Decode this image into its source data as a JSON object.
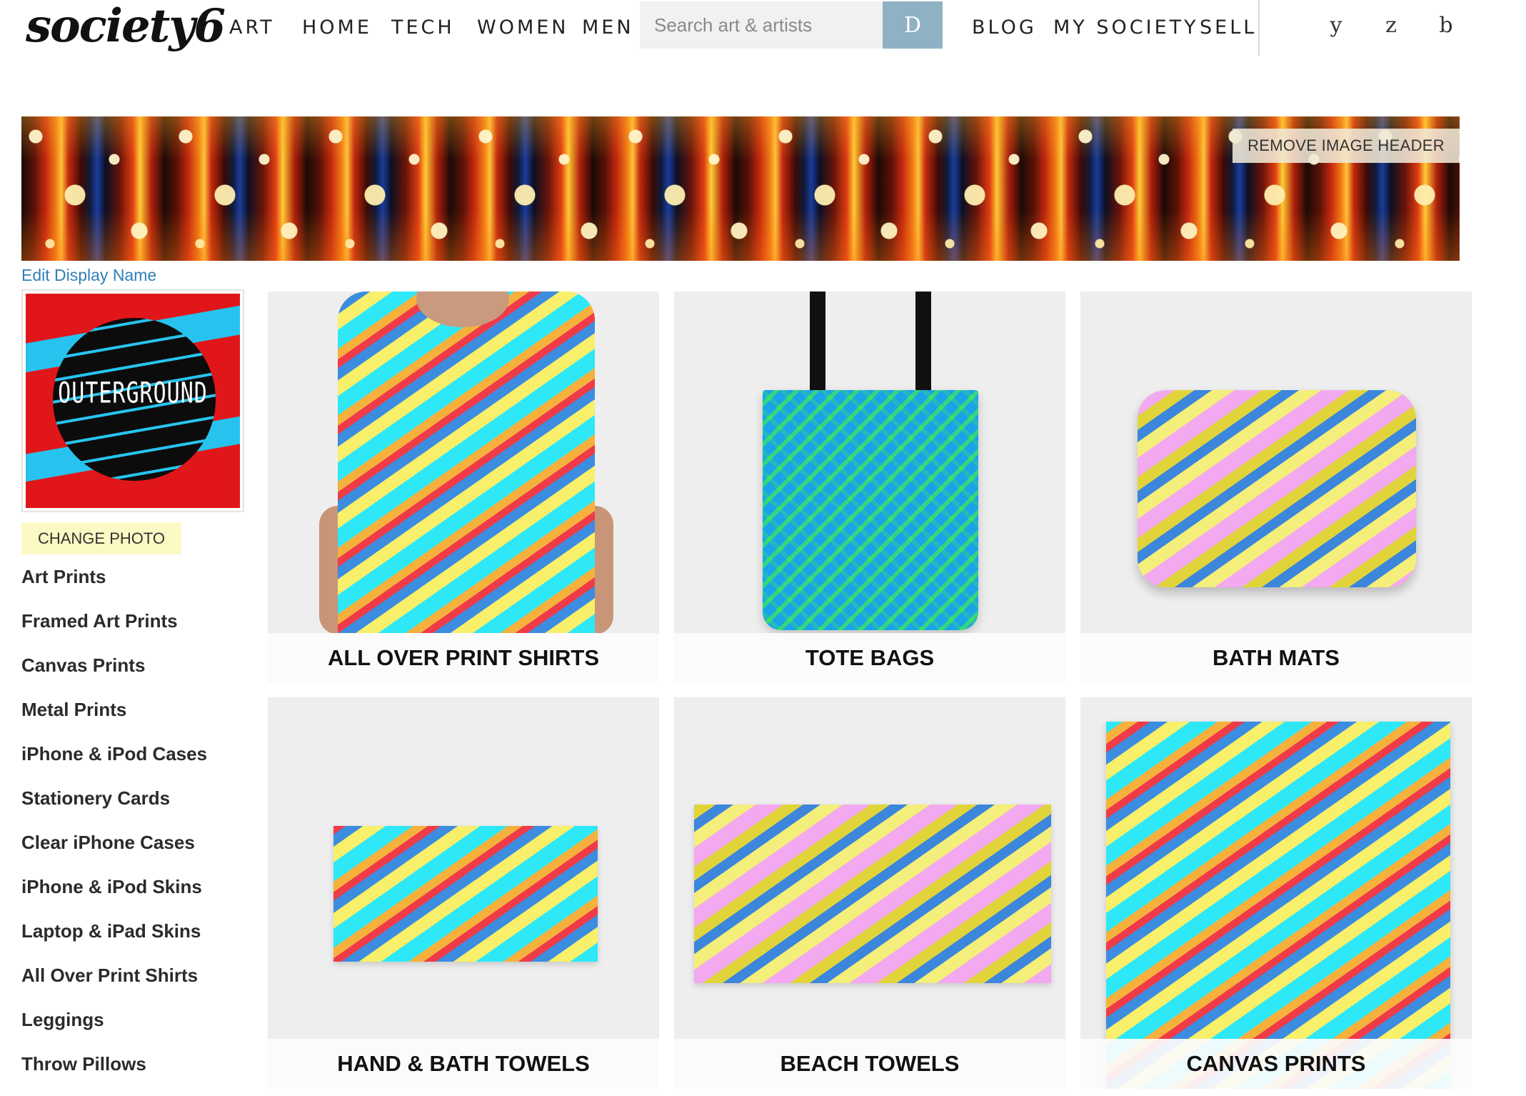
{
  "header": {
    "logo": "society6",
    "nav": [
      "ART",
      "HOME",
      "TECH",
      "WOMEN",
      "MEN"
    ],
    "search": {
      "placeholder": "Search art & artists",
      "button_glyph": "D"
    },
    "nav_right": [
      "BLOG",
      "MY SOCIETY",
      "SELL"
    ],
    "util_icons": [
      {
        "glyph": "y",
        "icon": "user-icon"
      },
      {
        "glyph": "z",
        "icon": "heart-icon"
      },
      {
        "glyph": "b",
        "icon": "cart-icon"
      }
    ]
  },
  "banner": {
    "remove_label": "REMOVE IMAGE HEADER"
  },
  "profile": {
    "edit_name_label": "Edit Display Name",
    "avatar_text": "OUTERGROUND",
    "change_photo_label": "CHANGE PHOTO"
  },
  "sidebar": {
    "items": [
      "Art Prints",
      "Framed Art Prints",
      "Canvas Prints",
      "Metal Prints",
      "iPhone & iPod Cases",
      "Stationery Cards",
      "Clear iPhone Cases",
      "iPhone & iPod Skins",
      "Laptop & iPad Skins",
      "All Over Print Shirts",
      "Leggings",
      "Throw Pillows"
    ]
  },
  "products": [
    {
      "label": "ALL OVER PRINT SHIRTS"
    },
    {
      "label": "TOTE BAGS"
    },
    {
      "label": "BATH MATS"
    },
    {
      "label": "HAND & BATH TOWELS"
    },
    {
      "label": "BEACH TOWELS"
    },
    {
      "label": "CANVAS PRINTS"
    }
  ],
  "colors": {
    "link_blue": "#2f7fb6",
    "search_button": "#8fb1c4",
    "change_photo_bg": "#fbf9c4",
    "avatar_red": "#e0161a",
    "avatar_cyan": "#27c3ee"
  }
}
